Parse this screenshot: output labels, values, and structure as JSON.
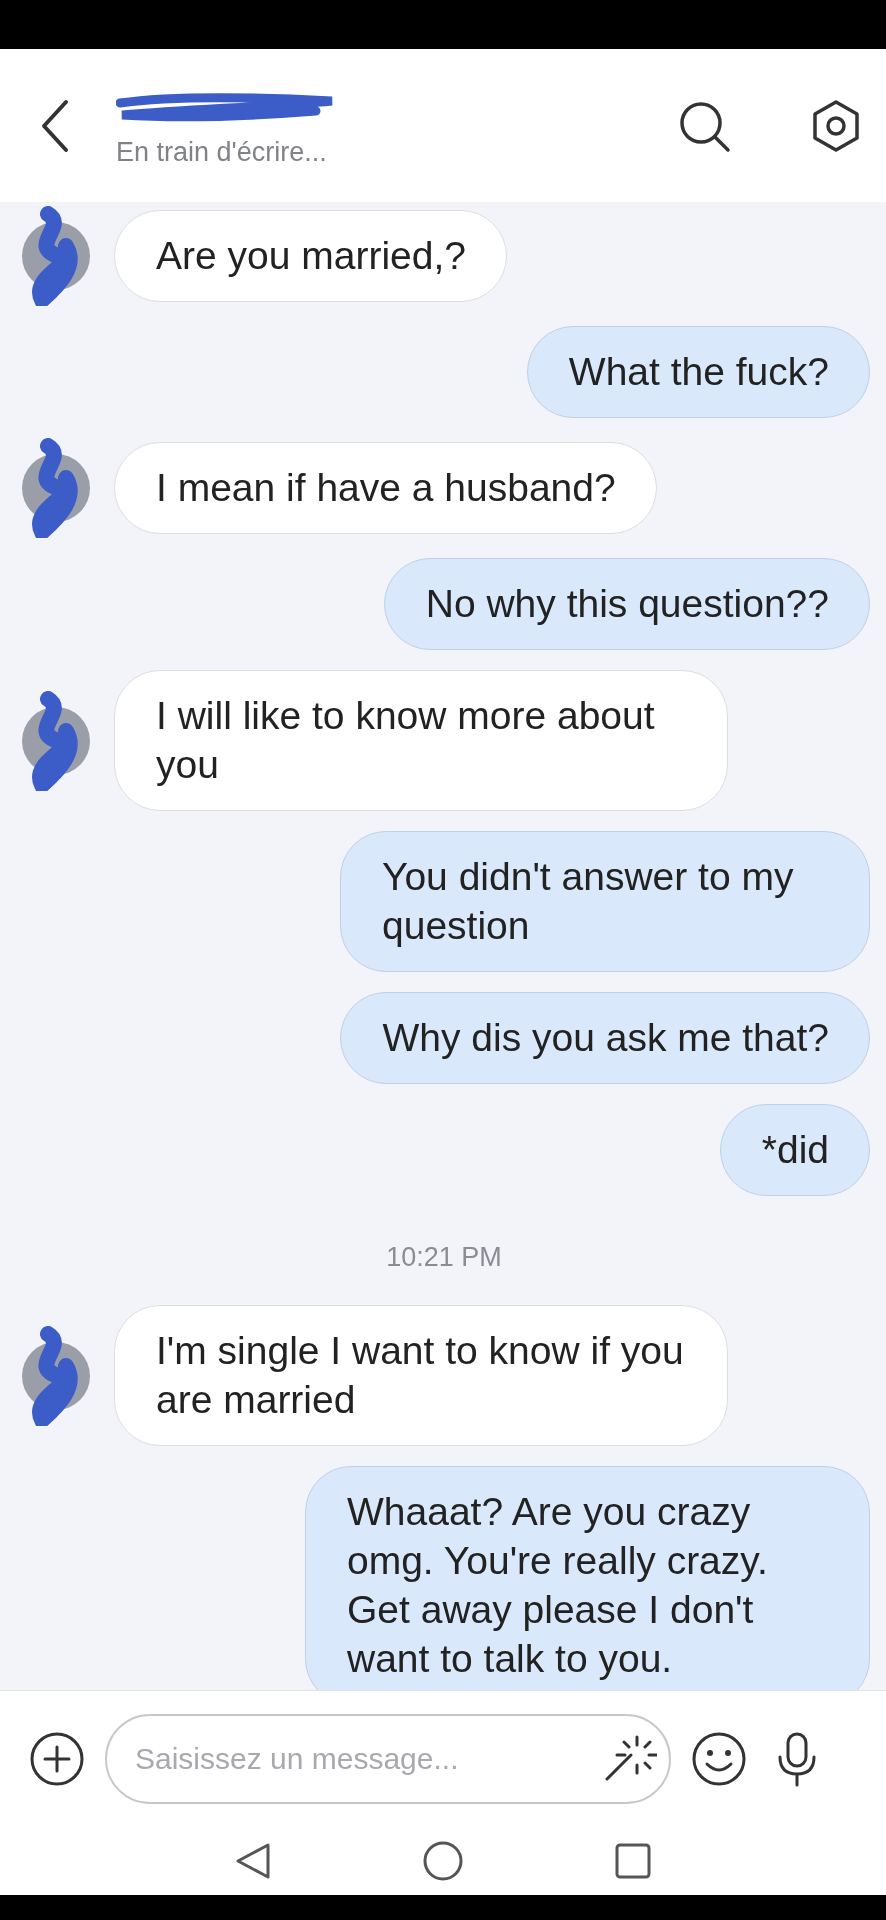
{
  "header": {
    "subtitle": "En train d'écrire..."
  },
  "messages": [
    {
      "kind": "incoming",
      "text": "Are you married,?"
    },
    {
      "kind": "outgoing",
      "text": "What the fuck?"
    },
    {
      "kind": "incoming",
      "text": "I mean if have a husband?"
    },
    {
      "kind": "outgoing",
      "text": "No why this question??"
    },
    {
      "kind": "incoming",
      "text": "I will like to know more about you"
    },
    {
      "kind": "outgoing",
      "text": "You didn't answer to my question"
    },
    {
      "kind": "outgoing",
      "text": "Why dis you ask me that?"
    },
    {
      "kind": "outgoing",
      "text": "*did"
    },
    {
      "kind": "time",
      "text": "10:21 PM"
    },
    {
      "kind": "incoming",
      "text": "I'm single I want to know if you are married"
    },
    {
      "kind": "outgoing",
      "text": "Whaaat? Are you crazy omg. You're really crazy. Get away please I don't want to talk to you."
    }
  ],
  "composer": {
    "placeholder": "Saisissez un message..."
  }
}
